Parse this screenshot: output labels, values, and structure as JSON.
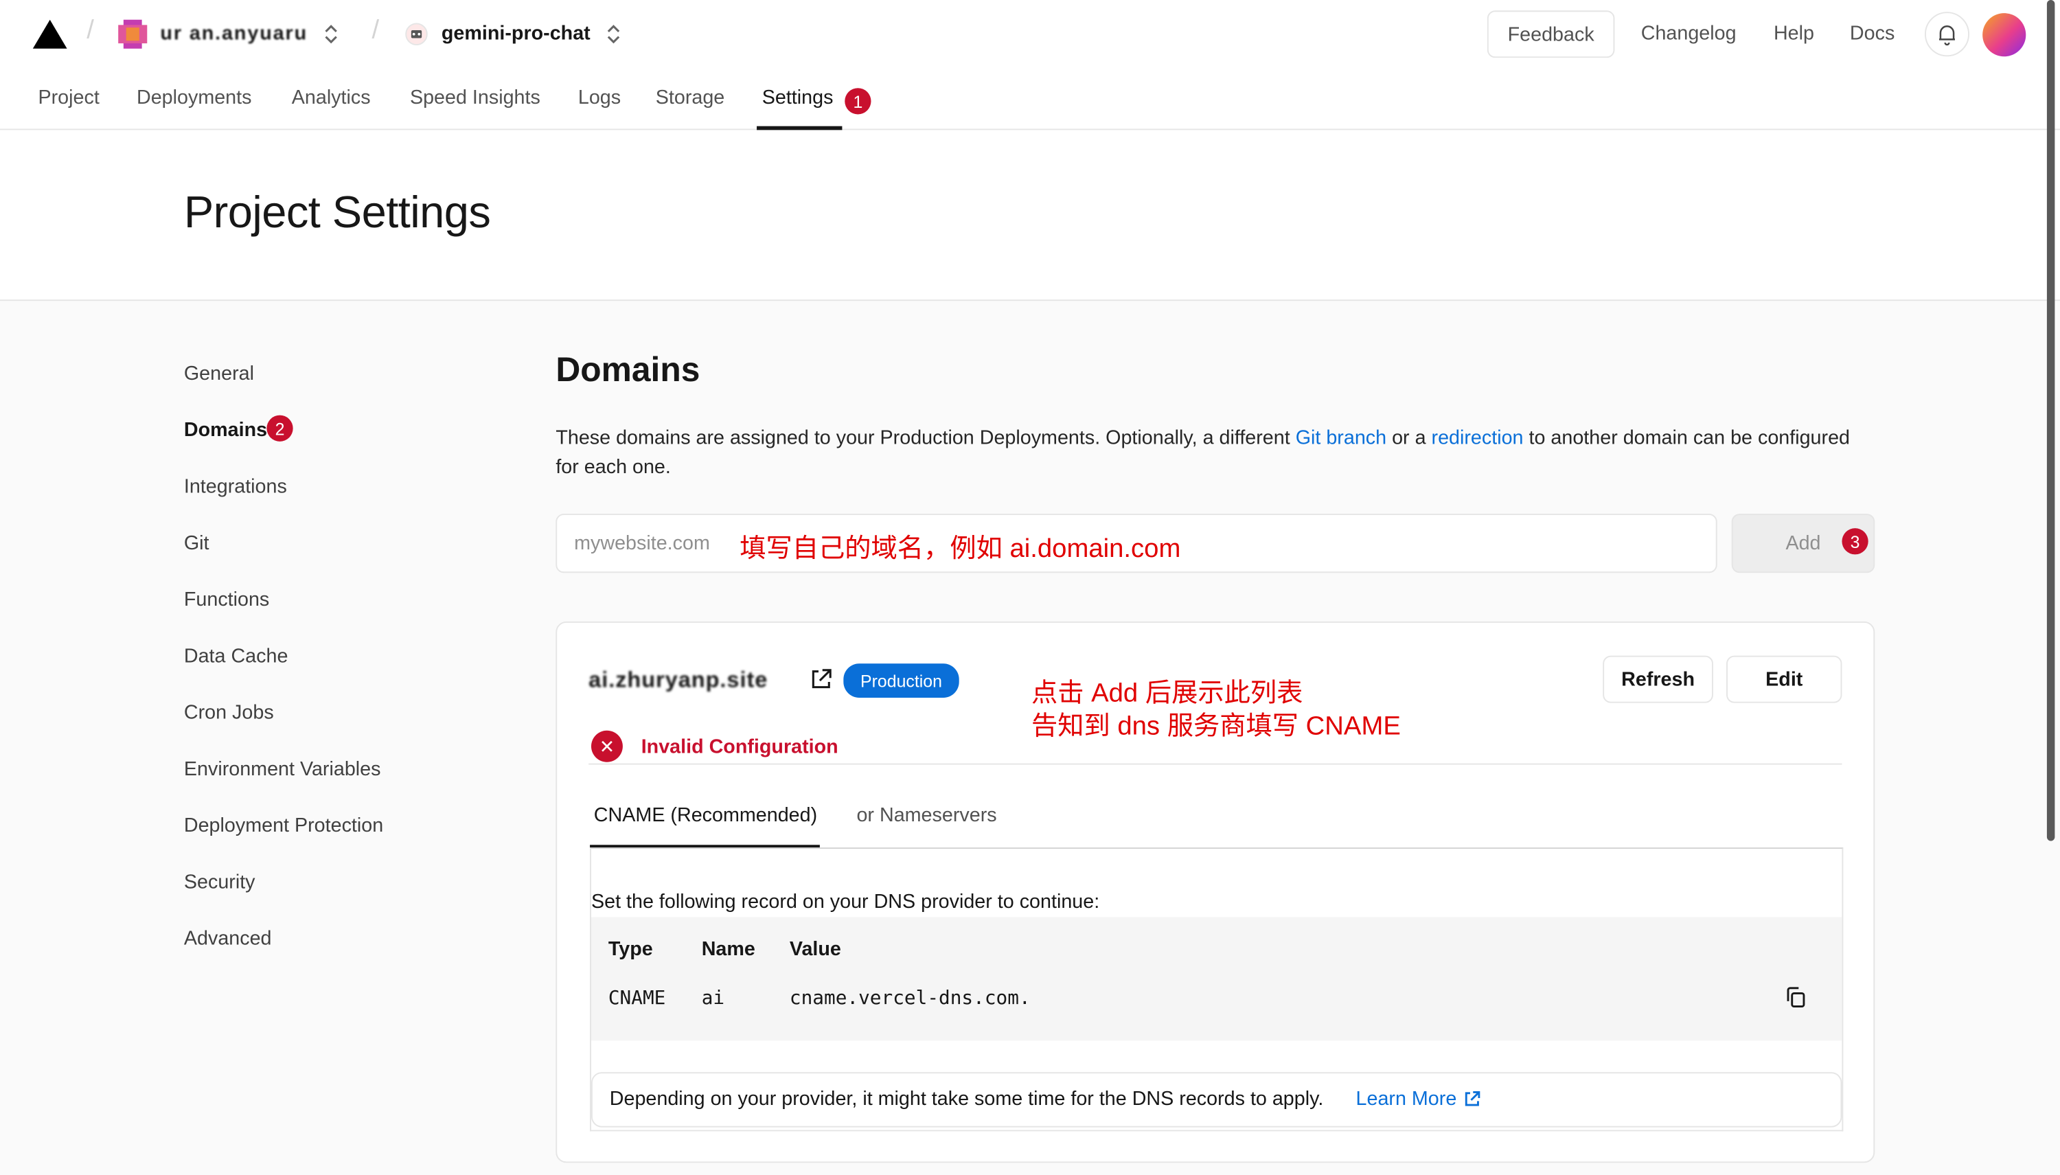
{
  "header": {
    "team_name": "ur an.anyuaru",
    "project_name": "gemini-pro-chat",
    "links": [
      "Feedback",
      "Changelog",
      "Help",
      "Docs"
    ]
  },
  "nav": {
    "tabs": [
      "Project",
      "Deployments",
      "Analytics",
      "Speed Insights",
      "Logs",
      "Storage",
      "Settings"
    ],
    "active": "Settings"
  },
  "annotations": {
    "badge1": "1",
    "badge2": "2",
    "badge3": "3",
    "input_note": "填写自己的域名，例如 ai.domain.com",
    "list_note_line1": "点击 Add 后展示此列表",
    "list_note_line2": "告知到 dns 服务商填写 CNAME"
  },
  "page": {
    "title": "Project Settings"
  },
  "sidebar": {
    "items": [
      "General",
      "Domains",
      "Integrations",
      "Git",
      "Functions",
      "Data Cache",
      "Cron Jobs",
      "Environment Variables",
      "Deployment Protection",
      "Security",
      "Advanced"
    ],
    "active": "Domains"
  },
  "domains": {
    "title": "Domains",
    "description_pre": "These domains are assigned to your Production Deployments. Optionally, a different ",
    "git_branch_link": "Git branch",
    "description_mid": " or a ",
    "redirection_link": "redirection",
    "description_post": " to another domain can be configured for each one.",
    "input_placeholder": "mywebsite.com",
    "add_label": "Add"
  },
  "domain_card": {
    "domain_name": "ai.zhuryanp.site",
    "env_badge": "Production",
    "refresh_label": "Refresh",
    "edit_label": "Edit",
    "status": "Invalid Configuration",
    "tabs": [
      "CNAME (Recommended)",
      "or Nameservers"
    ],
    "active_tab": "CNAME (Recommended)",
    "instruction": "Set the following record on your DNS provider to continue:",
    "record_headers": [
      "Type",
      "Name",
      "Value"
    ],
    "record": {
      "type": "CNAME",
      "name": "ai",
      "value": "cname.vercel-dns.com."
    },
    "footer_note": "Depending on your provider, it might take some time for the DNS records to apply.",
    "learn_more": "Learn More"
  },
  "colors": {
    "accent_blue": "#0a6fd8",
    "error_red": "#c8102e",
    "annotation_red": "#e00000"
  }
}
